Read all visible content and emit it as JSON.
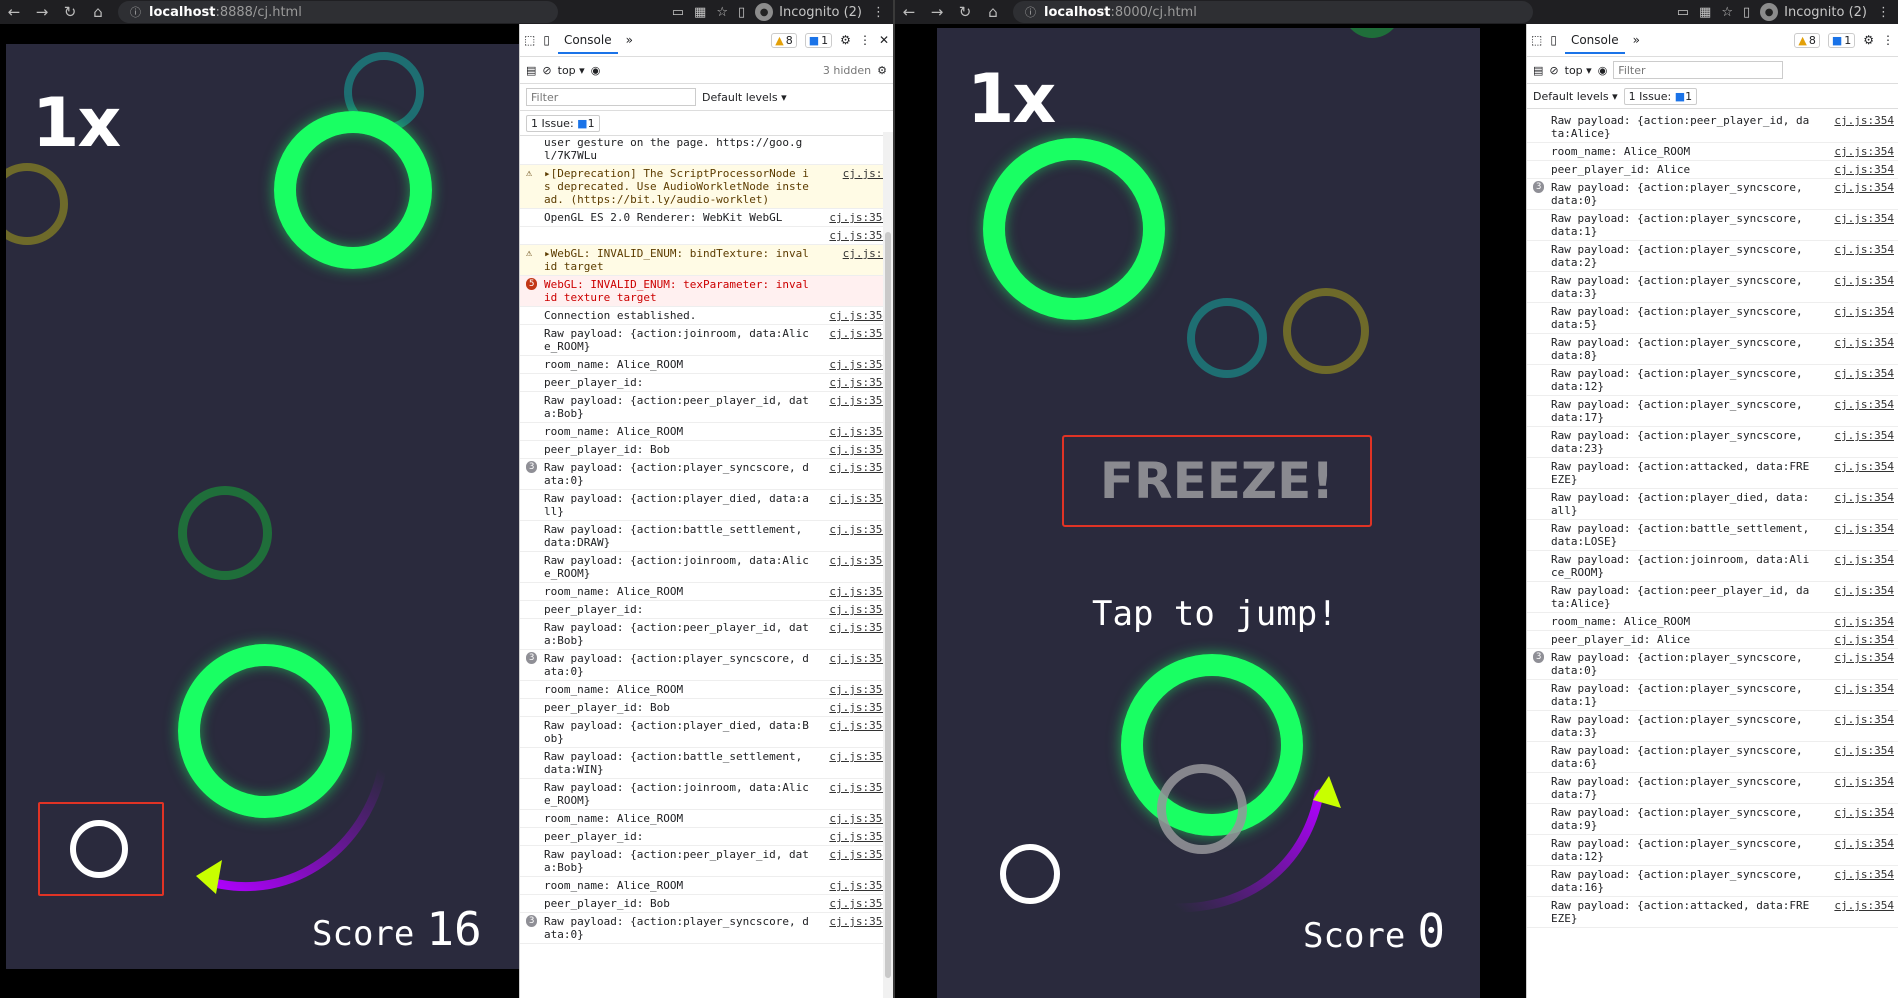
{
  "left": {
    "url_host": "localhost",
    "url_rest": ":8888/cj.html",
    "incognito": "Incognito (2)",
    "game": {
      "multiplier": "1x",
      "score_label": "Score",
      "score_value": "16"
    },
    "devtools": {
      "tab": "Console",
      "warn_count": "8",
      "msg_count": "1",
      "context": "top",
      "hidden": "3 hidden",
      "filter_placeholder": "Filter",
      "levels": "Default levels",
      "issue": "1 Issue:",
      "issue_count": "1",
      "logs": [
        {
          "type": "normal",
          "count": "",
          "msg": "user gesture on the page. https://goo.gl/7K7WLu",
          "src": ""
        },
        {
          "type": "warn",
          "count": "",
          "msg": "▸[Deprecation] The ScriptProcessorNode is deprecated. Use AudioWorkletNode instead. (https://bit.ly/audio-worklet)",
          "src": "cj.js:9"
        },
        {
          "type": "normal",
          "count": "",
          "msg": "OpenGL ES 2.0 Renderer: WebKit WebGL",
          "src": "cj.js:354"
        },
        {
          "type": "normal",
          "count": "",
          "msg": "",
          "src": "cj.js:354"
        },
        {
          "type": "warn",
          "count": "",
          "msg": "▸WebGL: INVALID_ENUM: bindTexture: invalid target",
          "src": "cj.js:9"
        },
        {
          "type": "err",
          "count": "5",
          "msg": "WebGL: INVALID_ENUM: texParameter: invalid texture target",
          "src": ""
        },
        {
          "type": "normal",
          "count": "",
          "msg": "Connection established.",
          "src": "cj.js:354"
        },
        {
          "type": "normal",
          "count": "",
          "msg": "Raw payload: {action:joinroom, data:Alice_ROOM}",
          "src": "cj.js:354"
        },
        {
          "type": "normal",
          "count": "",
          "msg": "room_name: Alice_ROOM",
          "src": "cj.js:354"
        },
        {
          "type": "normal",
          "count": "",
          "msg": "peer_player_id:",
          "src": "cj.js:354"
        },
        {
          "type": "normal",
          "count": "",
          "msg": "Raw payload: {action:peer_player_id, data:Bob}",
          "src": "cj.js:354"
        },
        {
          "type": "normal",
          "count": "",
          "msg": "room_name: Alice_ROOM",
          "src": "cj.js:354"
        },
        {
          "type": "normal",
          "count": "",
          "msg": "peer_player_id: Bob",
          "src": "cj.js:354"
        },
        {
          "type": "normal",
          "count": "3",
          "msg": "Raw payload: {action:player_syncscore, data:0}",
          "src": "cj.js:354"
        },
        {
          "type": "normal",
          "count": "",
          "msg": "Raw payload: {action:player_died, data:all}",
          "src": "cj.js:354"
        },
        {
          "type": "normal",
          "count": "",
          "msg": "Raw payload: {action:battle_settlement, data:DRAW}",
          "src": "cj.js:354"
        },
        {
          "type": "normal",
          "count": "",
          "msg": "Raw payload: {action:joinroom, data:Alice_ROOM}",
          "src": "cj.js:354"
        },
        {
          "type": "normal",
          "count": "",
          "msg": "room_name: Alice_ROOM",
          "src": "cj.js:354"
        },
        {
          "type": "normal",
          "count": "",
          "msg": "peer_player_id:",
          "src": "cj.js:354"
        },
        {
          "type": "normal",
          "count": "",
          "msg": "Raw payload: {action:peer_player_id, data:Bob}",
          "src": "cj.js:354"
        },
        {
          "type": "normal",
          "count": "3",
          "msg": "Raw payload: {action:player_syncscore, data:0}",
          "src": "cj.js:354"
        },
        {
          "type": "normal",
          "count": "",
          "msg": "room_name: Alice_ROOM",
          "src": "cj.js:354"
        },
        {
          "type": "normal",
          "count": "",
          "msg": "peer_player_id: Bob",
          "src": "cj.js:354"
        },
        {
          "type": "normal",
          "count": "",
          "msg": "Raw payload: {action:player_died, data:Bob}",
          "src": "cj.js:354"
        },
        {
          "type": "normal",
          "count": "",
          "msg": "Raw payload: {action:battle_settlement, data:WIN}",
          "src": "cj.js:354"
        },
        {
          "type": "normal",
          "count": "",
          "msg": "Raw payload: {action:joinroom, data:Alice_ROOM}",
          "src": "cj.js:354"
        },
        {
          "type": "normal",
          "count": "",
          "msg": "room_name: Alice_ROOM",
          "src": "cj.js:354"
        },
        {
          "type": "normal",
          "count": "",
          "msg": "peer_player_id:",
          "src": "cj.js:354"
        },
        {
          "type": "normal",
          "count": "",
          "msg": "Raw payload: {action:peer_player_id, data:Bob}",
          "src": "cj.js:354"
        },
        {
          "type": "normal",
          "count": "",
          "msg": "room_name: Alice_ROOM",
          "src": "cj.js:354"
        },
        {
          "type": "normal",
          "count": "",
          "msg": "peer_player_id: Bob",
          "src": "cj.js:354"
        },
        {
          "type": "normal",
          "count": "3",
          "msg": "Raw payload: {action:player_syncscore, data:0}",
          "src": "cj.js:354"
        }
      ]
    }
  },
  "right": {
    "url_host": "localhost",
    "url_rest": ":8000/cj.html",
    "incognito": "Incognito (2)",
    "game": {
      "multiplier": "1x",
      "freeze": "FREEZE!",
      "tap": "Tap to jump!",
      "score_label": "Score",
      "score_value": "0"
    },
    "devtools": {
      "tab": "Console",
      "warn_count": "8",
      "msg_count": "1",
      "context": "top",
      "filter_placeholder": "Filter",
      "levels": "Default levels",
      "issue": "1 Issue:",
      "issue_count": "1",
      "logs": [
        {
          "type": "normal",
          "count": "",
          "msg": "Raw payload: {action:peer_player_id, data:Alice}",
          "src": "cj.js:354"
        },
        {
          "type": "normal",
          "count": "",
          "msg": "room_name: Alice_ROOM",
          "src": "cj.js:354"
        },
        {
          "type": "normal",
          "count": "",
          "msg": "peer_player_id: Alice",
          "src": "cj.js:354"
        },
        {
          "type": "normal",
          "count": "3",
          "msg": "Raw payload: {action:player_syncscore, data:0}",
          "src": "cj.js:354"
        },
        {
          "type": "normal",
          "count": "",
          "msg": "Raw payload: {action:player_syncscore, data:1}",
          "src": "cj.js:354"
        },
        {
          "type": "normal",
          "count": "",
          "msg": "Raw payload: {action:player_syncscore, data:2}",
          "src": "cj.js:354"
        },
        {
          "type": "normal",
          "count": "",
          "msg": "Raw payload: {action:player_syncscore, data:3}",
          "src": "cj.js:354"
        },
        {
          "type": "normal",
          "count": "",
          "msg": "Raw payload: {action:player_syncscore, data:5}",
          "src": "cj.js:354"
        },
        {
          "type": "normal",
          "count": "",
          "msg": "Raw payload: {action:player_syncscore, data:8}",
          "src": "cj.js:354"
        },
        {
          "type": "normal",
          "count": "",
          "msg": "Raw payload: {action:player_syncscore, data:12}",
          "src": "cj.js:354"
        },
        {
          "type": "normal",
          "count": "",
          "msg": "Raw payload: {action:player_syncscore, data:17}",
          "src": "cj.js:354"
        },
        {
          "type": "normal",
          "count": "",
          "msg": "Raw payload: {action:player_syncscore, data:23}",
          "src": "cj.js:354"
        },
        {
          "type": "normal",
          "count": "",
          "msg": "Raw payload: {action:attacked, data:FREEZE}",
          "src": "cj.js:354"
        },
        {
          "type": "normal",
          "count": "",
          "msg": "Raw payload: {action:player_died, data:all}",
          "src": "cj.js:354"
        },
        {
          "type": "normal",
          "count": "",
          "msg": "Raw payload: {action:battle_settlement, data:LOSE}",
          "src": "cj.js:354"
        },
        {
          "type": "normal",
          "count": "",
          "msg": "Raw payload: {action:joinroom, data:Alice_ROOM}",
          "src": "cj.js:354"
        },
        {
          "type": "normal",
          "count": "",
          "msg": "Raw payload: {action:peer_player_id, data:Alice}",
          "src": "cj.js:354"
        },
        {
          "type": "normal",
          "count": "",
          "msg": "room_name: Alice_ROOM",
          "src": "cj.js:354"
        },
        {
          "type": "normal",
          "count": "",
          "msg": "peer_player_id: Alice",
          "src": "cj.js:354"
        },
        {
          "type": "normal",
          "count": "3",
          "msg": "Raw payload: {action:player_syncscore, data:0}",
          "src": "cj.js:354"
        },
        {
          "type": "normal",
          "count": "",
          "msg": "Raw payload: {action:player_syncscore, data:1}",
          "src": "cj.js:354"
        },
        {
          "type": "normal",
          "count": "",
          "msg": "Raw payload: {action:player_syncscore, data:3}",
          "src": "cj.js:354"
        },
        {
          "type": "normal",
          "count": "",
          "msg": "Raw payload: {action:player_syncscore, data:6}",
          "src": "cj.js:354"
        },
        {
          "type": "normal",
          "count": "",
          "msg": "Raw payload: {action:player_syncscore, data:7}",
          "src": "cj.js:354"
        },
        {
          "type": "normal",
          "count": "",
          "msg": "Raw payload: {action:player_syncscore, data:9}",
          "src": "cj.js:354"
        },
        {
          "type": "normal",
          "count": "",
          "msg": "Raw payload: {action:player_syncscore, data:12}",
          "src": "cj.js:354"
        },
        {
          "type": "normal",
          "count": "",
          "msg": "Raw payload: {action:player_syncscore, data:16}",
          "src": "cj.js:354"
        },
        {
          "type": "normal",
          "count": "",
          "msg": "Raw payload: {action:attacked, data:FREEZE}",
          "src": "cj.js:354"
        }
      ]
    }
  },
  "colors": {
    "game_bg": "#2a2a3d",
    "ring_green": "#19ff63",
    "highlight_red": "#e03325",
    "arrow_yellow": "#c8ff00",
    "arc_purple": "#b000ff"
  }
}
